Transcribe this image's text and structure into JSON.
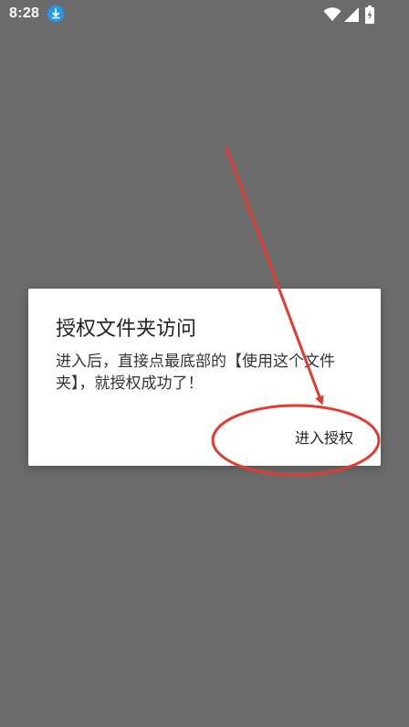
{
  "status_bar": {
    "time": "8:28",
    "download_icon": "download-icon",
    "wifi_icon": "wifi-icon",
    "signal_icon": "signal-icon",
    "battery_icon": "battery-charging-icon"
  },
  "dialog": {
    "title": "授权文件夹访问",
    "message": "进入后，直接点最底部的【使用这个文件夹】，就授权成功了！",
    "confirm_label": "进入授权"
  },
  "colors": {
    "overlay": "#6b6b6b",
    "dialog_bg": "#ffffff",
    "accent_blue": "#1e9bf0",
    "annotation_red": "#e23b30"
  }
}
